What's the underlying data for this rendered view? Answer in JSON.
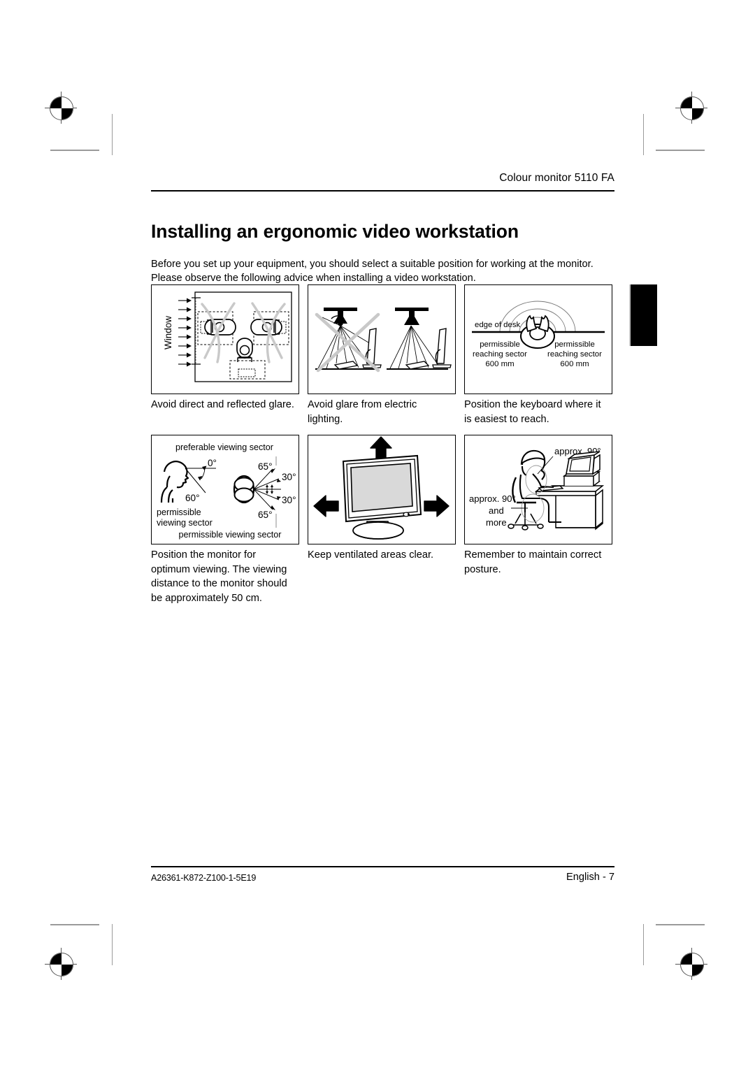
{
  "document": {
    "header": "Colour monitor 5110 FA",
    "title": "Installing an ergonomic video workstation",
    "intro": "Before you set up your equipment, you should select a suitable position for working at the monitor. Please observe the following advice when installing a video workstation.",
    "footer_left": "A26361-K872-Z100-1-5E19",
    "footer_right": "English -  7"
  },
  "figures": [
    {
      "id": "glare-window",
      "caption": "Avoid direct and reflected glare.",
      "labels": {
        "window": "Window"
      }
    },
    {
      "id": "glare-electric-lighting",
      "caption": "Avoid glare from electric lighting.",
      "labels": {}
    },
    {
      "id": "keyboard-reach",
      "caption": "Position the keyboard where it is easiest to reach.",
      "labels": {
        "edge_of_desk": "edge of desk",
        "left_sector_line1": "permissible",
        "left_sector_line2": "reaching sector",
        "left_sector_line3": "600 mm",
        "right_sector_line1": "permissible",
        "right_sector_line2": "reaching sector",
        "right_sector_line3": "600 mm"
      }
    },
    {
      "id": "viewing-sector",
      "caption": "Position the monitor for optimum viewing. The viewing distance to the monitor should be approximately 50 cm.",
      "labels": {
        "preferable": "preferable viewing sector",
        "permissible_left_line1": "permissible",
        "permissible_left_line2": "viewing sector",
        "permissible_bottom": "permissible viewing sector",
        "angle_0": "0°",
        "angle_60": "60°",
        "angle_65_top": "65°",
        "angle_30_top": "30°",
        "angle_30_bottom": "30°",
        "angle_65_bottom": "65°"
      }
    },
    {
      "id": "ventilation",
      "caption": "Keep ventilated areas clear.",
      "labels": {}
    },
    {
      "id": "posture",
      "caption": "Remember to maintain correct posture.",
      "labels": {
        "angle_upper": "approx. 90°",
        "angle_lower_line1": "approx. 90°",
        "angle_lower_line2": "and",
        "angle_lower_line3": "more"
      }
    }
  ],
  "colors": {
    "ink": "#000000",
    "strikethrough": "#c9c9c9",
    "screen_fill": "#d9d9d9",
    "crop_mark": "#9a9a9a"
  }
}
